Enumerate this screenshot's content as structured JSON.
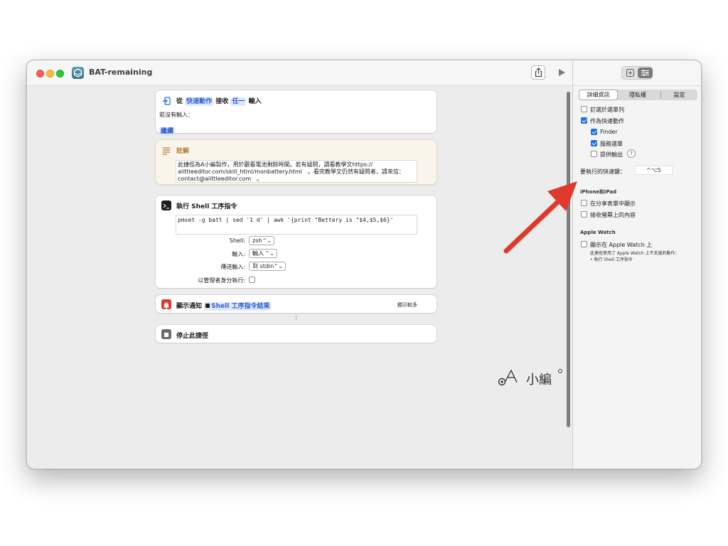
{
  "window": {
    "title": "BAT-remaining"
  },
  "colors": {
    "accent": "#1f6fe5",
    "token": "#2f5fd6",
    "comment_header": "#b07a2a",
    "arrow": "#e0392b",
    "notify": "#e0392b"
  },
  "actions": {
    "receive": {
      "prefix": "從",
      "token_source": "快速動作",
      "mid": "接收",
      "token_type": "任一",
      "suffix": "輸入",
      "no_input_label": "若沒有輸入：",
      "no_input_token": "繼續"
    },
    "comment": {
      "title": "註解",
      "line1": "此捷徑為A小編製作，用於觀看電池剩餘時間。若有疑問，請看教學文https://",
      "line2": "alittleeditor.com/skill_html/monbattery.html　。看完教學文仍然有疑問者，請來信：",
      "line3": "contact@alittleeditor.com　。"
    },
    "shell": {
      "title": "執行 Shell 工序指令",
      "script": "pmset -g batt | sed '1 d' | awk '{print \"Bettery is \"$4,$5,$6}'",
      "shell_label": "Shell:",
      "shell_value": "zsh",
      "input_label": "輸入:",
      "input_value": "輸入",
      "pass_label": "傳送輸入:",
      "pass_value": "到 stdin",
      "admin_label": "以管理者身分執行:"
    },
    "notify": {
      "title": "顯示通知",
      "token": "Shell 工序指令結果",
      "more": "顯示較多"
    },
    "stop": {
      "title": "停止此捷徑"
    }
  },
  "sidebar": {
    "tabs": [
      "詳細資訊",
      "隱私權",
      "設定"
    ],
    "pin_menu": "釘選於選單列",
    "quick_action": "作為快速動作",
    "finder": "Finder",
    "services": "服務選單",
    "provide_output": "提供輸出",
    "help": "?",
    "shortcut_label": "要執行的快速鍵：",
    "shortcut_value": "^⌥5",
    "iphone_head": "iPhone和iPad",
    "show_share_sheet": "在分享表單中顯示",
    "receive_screen": "接收螢幕上的內容",
    "watch_head": "Apple Watch",
    "show_watch": "顯示在 Apple Watch 上",
    "watch_note1": "此捷徑使用了 Apple Watch 上不支援的動作：",
    "watch_note2": "• 執行 Shell 工序指令"
  },
  "watermark": {
    "text": "小編"
  }
}
